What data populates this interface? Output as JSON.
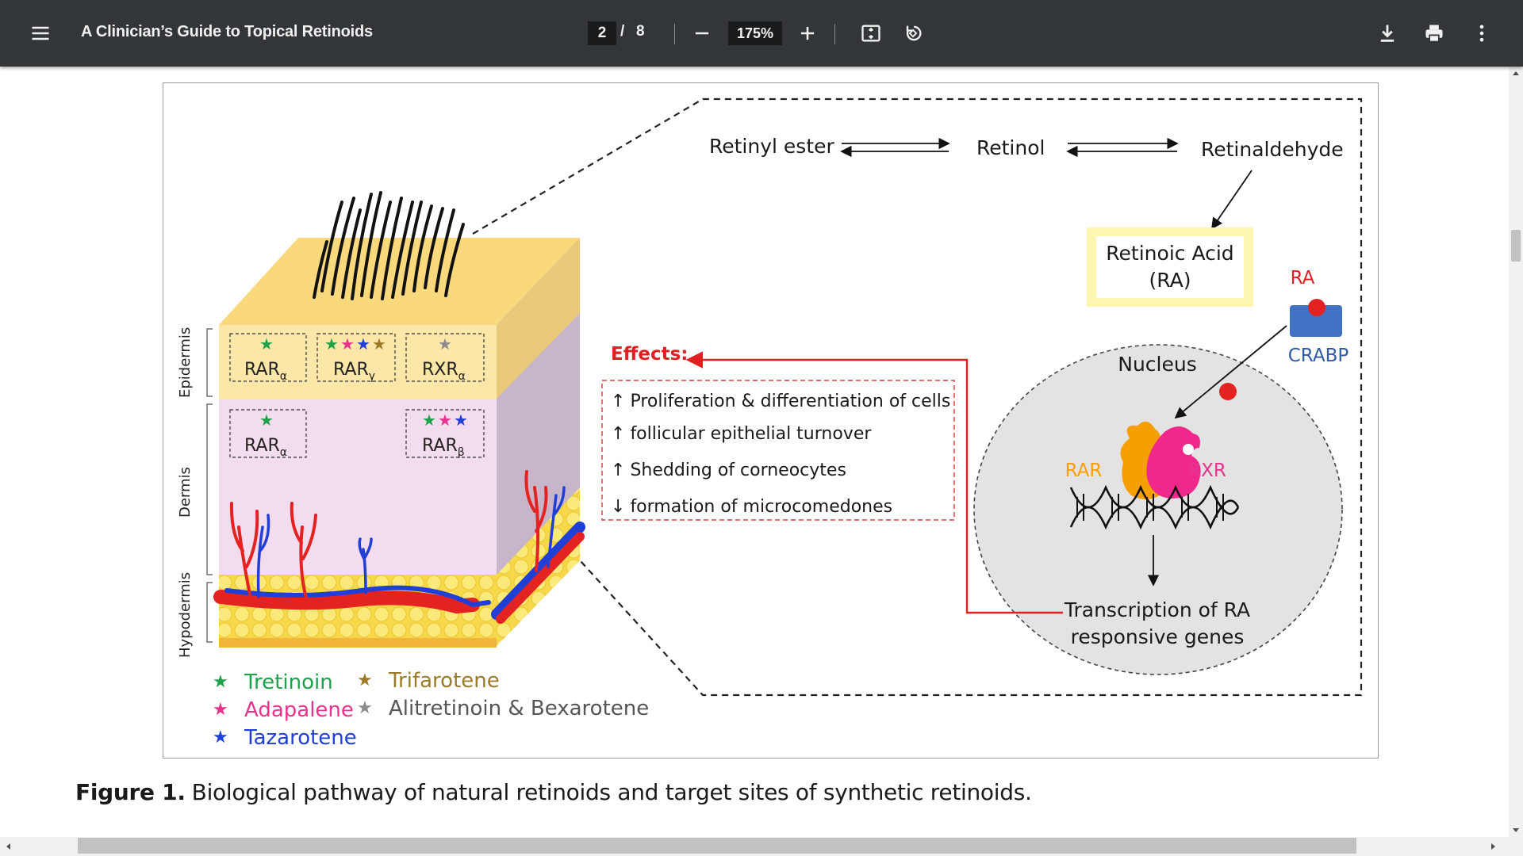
{
  "toolbar": {
    "title": "A Clinician’s Guide to Topical Retinoids",
    "page_current": "2",
    "page_separator": "/",
    "page_total": "8",
    "zoom": "175%",
    "icons": [
      "menu-icon",
      "zoom-out-icon",
      "zoom-in-icon",
      "fit-page-icon",
      "rotate-icon",
      "download-icon",
      "print-icon",
      "more-vert-icon"
    ]
  },
  "figure": {
    "pathway": {
      "retinyl_ester": "Retinyl ester",
      "retinol": "Retinol",
      "retinaldehyde": "Retinaldehyde",
      "retinoic_acid_line1": "Retinoic Acid",
      "retinoic_acid_line2": "(RA)",
      "ra_label": "RA",
      "crabp_label": "CRABP",
      "nucleus_label": "Nucleus",
      "rar_label": "RAR",
      "rxr_label": "RXR",
      "transcription_line1": "Transcription of RA",
      "transcription_line2": "responsive genes"
    },
    "effects": {
      "title": "Effects:",
      "items": [
        {
          "arrow": "↑",
          "text": "Proliferation & differentiation of cells"
        },
        {
          "arrow": "↑",
          "text": "follicular epithelial turnover"
        },
        {
          "arrow": "↑",
          "text": "Shedding of corneocytes"
        },
        {
          "arrow": "↓",
          "text": "formation of microcomedones"
        }
      ]
    },
    "skin": {
      "layer_labels": [
        "Epidermis",
        "Dermis",
        "Hypodermis"
      ],
      "receptors": {
        "epi_1": {
          "base": "RAR",
          "sub": "α"
        },
        "epi_2": {
          "base": "RAR",
          "sub": "γ"
        },
        "epi_3": {
          "base": "RXR",
          "sub": "α"
        },
        "der_1": {
          "base": "RAR",
          "sub": "α"
        },
        "der_2": {
          "base": "RAR",
          "sub": "β"
        }
      }
    },
    "legend": [
      {
        "name": "Tretinoin",
        "color": "#1fa14a"
      },
      {
        "name": "Adapalene",
        "color": "#e8338c"
      },
      {
        "name": "Tazarotene",
        "color": "#1f3fd6"
      },
      {
        "name": "Trifarotene",
        "color": "#9c7a2a"
      },
      {
        "name": "Alitretinoin & Bexarotene",
        "color": "#8c8c8c"
      }
    ],
    "colors": {
      "red_accent": "#e02020",
      "rar_orange": "#f5a000",
      "rxr_magenta": "#f0288c",
      "crabp_blue": "#4272c4"
    }
  },
  "caption": {
    "label": "Figure 1.",
    "text": "Biological pathway of natural retinoids and target sites of synthetic retinoids."
  }
}
